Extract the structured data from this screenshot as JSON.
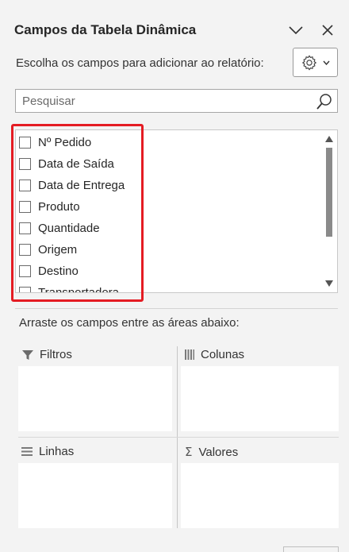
{
  "header": {
    "title": "Campos da Tabela Dinâmica",
    "collapse_icon": "chevron-down-icon",
    "close_icon": "close-icon"
  },
  "choose_fields": {
    "label": "Escolha os campos para adicionar ao relatório:",
    "settings_icon": "gear-icon",
    "dropdown_icon": "chevron-down-icon"
  },
  "search": {
    "placeholder": "Pesquisar",
    "value": "",
    "icon": "search-icon"
  },
  "fields": [
    {
      "label": "Nº Pedido",
      "checked": false
    },
    {
      "label": "Data de Saída",
      "checked": false
    },
    {
      "label": "Data de Entrega",
      "checked": false
    },
    {
      "label": "Produto",
      "checked": false
    },
    {
      "label": "Quantidade",
      "checked": false
    },
    {
      "label": "Origem",
      "checked": false
    },
    {
      "label": "Destino",
      "checked": false
    },
    {
      "label": "Transportadora",
      "checked": false
    }
  ],
  "areas": {
    "instruction": "Arraste os campos entre as áreas abaixo:",
    "filters": {
      "label": "Filtros",
      "icon": "filter-icon"
    },
    "columns": {
      "label": "Colunas",
      "icon": "columns-icon"
    },
    "rows": {
      "label": "Linhas",
      "icon": "rows-icon"
    },
    "values": {
      "label": "Valores",
      "icon": "sigma-icon"
    }
  },
  "colors": {
    "highlight": "#e41c23",
    "panel_bg": "#f3f3f3",
    "box_bg": "#ffffff",
    "text": "#262626"
  }
}
